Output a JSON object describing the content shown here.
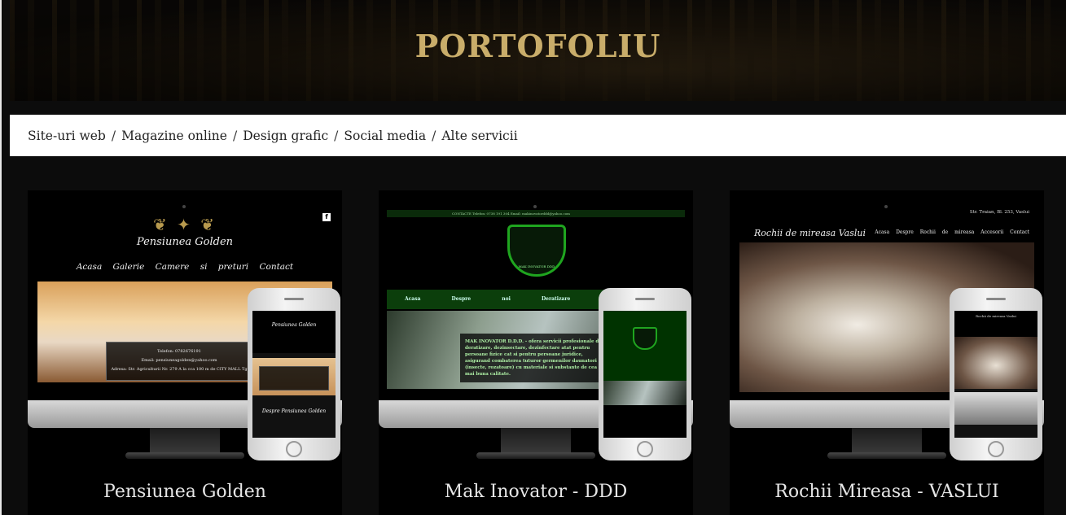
{
  "page": {
    "title": "PORTOFOLIU"
  },
  "filters": [
    {
      "label": "Site-uri web"
    },
    {
      "label": "Magazine online"
    },
    {
      "label": "Design grafic"
    },
    {
      "label": "Social media"
    },
    {
      "label": "Alte servicii"
    }
  ],
  "filter_separator": "/",
  "projects": [
    {
      "title": "Pensiunea Golden",
      "screen": {
        "logo": "Pensiunea Golden",
        "nav": "Acasa Galerie Camere si preturi Contact",
        "info": [
          "Telefon: 0782676191",
          "Email: pensiuneagolden@yahoo.com",
          "Adresa: Str. Agriculturii Nr. 279 A la cca 100 m de CITY MALL Tg"
        ],
        "phone_footer": "Despre Pensiunea Golden"
      }
    },
    {
      "title": "Mak Inovator - DDD",
      "screen": {
        "topbar": "CONTACTE   Telefon: 0738 191 304   Email: makinovatorddd@yahoo.com",
        "shield": "MAK INOVATOR DDD",
        "nav": "Acasa Despre noi Deratizare Dezinsectie",
        "overlay": "MAK INOVATOR D.D.D. - ofera servicii profesionale de deratizare, dezinsectare, dezinfectare atat pentru persoane fizice cat si pentru persoane juridice, asigurand combaterea tuturor germenilor daunatori (insecte, rozatoare) cu materiale si substante de cea mai buna calitate."
      }
    },
    {
      "title": "Rochii Mireasa - VASLUI",
      "screen": {
        "address": "Str. Traian, Bl. 253, Vaslui",
        "brand": "Rochii de mireasa Vaslui",
        "menu": "Acasa Despre Rochii de mireasa Accesorii Contact"
      }
    }
  ]
}
